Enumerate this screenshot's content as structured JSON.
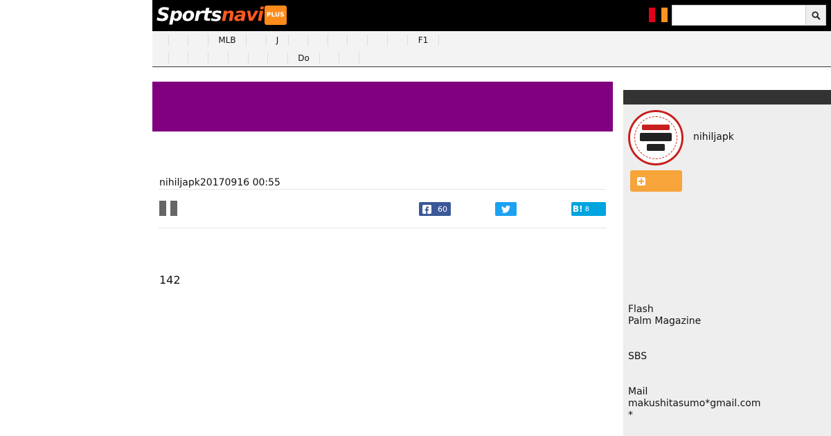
{
  "header": {
    "logo": {
      "sports": "Sports",
      "navi": "navi",
      "plus": "PLUS"
    },
    "search": {
      "placeholder": "",
      "value": ""
    }
  },
  "nav": {
    "row1": [
      "",
      "",
      "",
      "MLB",
      "",
      "J",
      "",
      "",
      "",
      "",
      "",
      "",
      "F1"
    ],
    "row2": [
      "",
      "",
      "",
      "",
      "",
      "",
      "",
      "Do",
      "",
      ""
    ]
  },
  "banner": {
    "color": "#800080"
  },
  "article": {
    "byline": "nihiljapk20170916 00:55",
    "share": {
      "facebook_count": "60",
      "hatena_label": "B!",
      "hatena_count": "8"
    },
    "body": "142"
  },
  "sidebar": {
    "username": "nihiljapk",
    "profile_lines": [
      "Flash",
      "Palm Magazine",
      "",
      "SBS",
      "",
      "Mail",
      "makushitasumo*gmail.com",
      "*"
    ]
  },
  "colors": {
    "facebook": "#3b5998",
    "twitter": "#1da1f2",
    "hatena": "#00a4de",
    "follow": "#f7a43a"
  }
}
